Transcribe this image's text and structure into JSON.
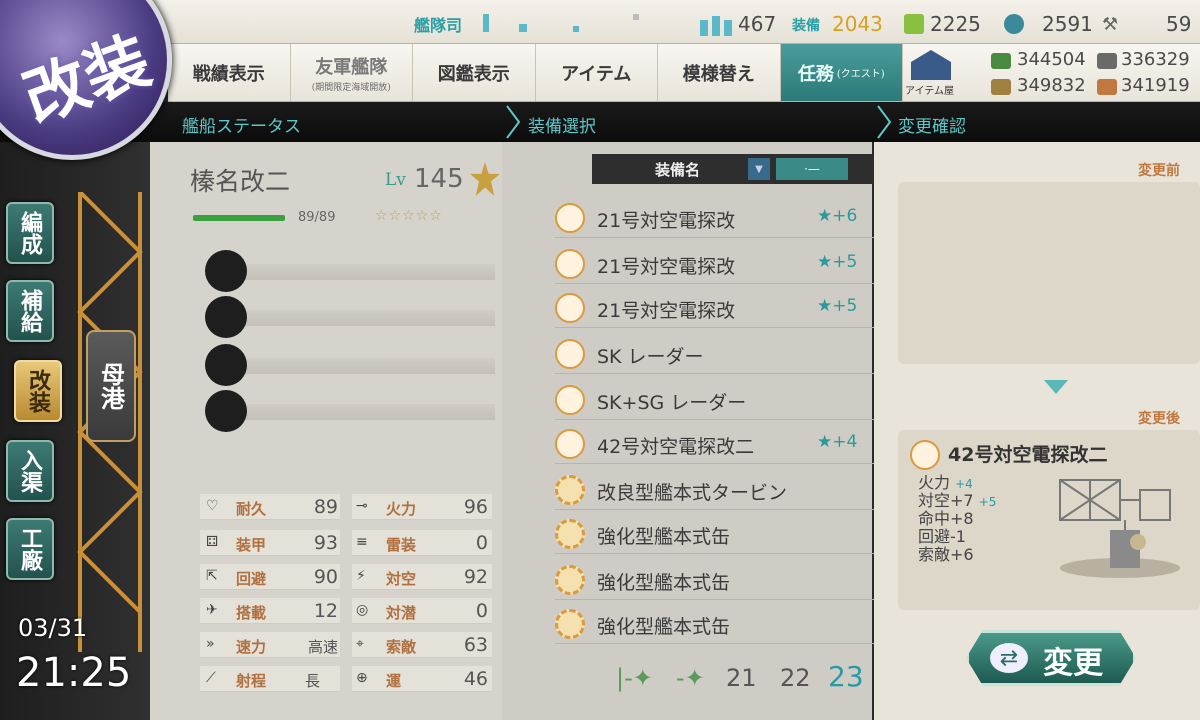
{
  "topbar": {
    "admiral_label": "艦隊司",
    "ship_count": "467",
    "equip_label": "装備",
    "equip_count": "2043",
    "bucket": "2225",
    "dev_material": "2591",
    "improve_material": "59"
  },
  "menu": {
    "items": [
      {
        "label": "戦績表示",
        "sub": ""
      },
      {
        "label": "友軍艦隊",
        "sub": "(期間限定海域開放)"
      },
      {
        "label": "図鑑表示",
        "sub": ""
      },
      {
        "label": "アイテム",
        "sub": ""
      },
      {
        "label": "模様替え",
        "sub": ""
      },
      {
        "label": "任務",
        "sub": "(クエスト)"
      }
    ],
    "item_shop_label": "アイテム屋"
  },
  "resources": {
    "fuel": "344504",
    "ammo": "349832",
    "steel": "336329",
    "bauxite": "341919"
  },
  "headers": {
    "ship_status": "艦船ステータス",
    "equip_select": "装備選択",
    "change_confirm": "変更確認"
  },
  "sidebar": {
    "kaisou_label": "改装",
    "nav": [
      "編成",
      "補給",
      "改装",
      "入渠",
      "工廠"
    ],
    "port_label": "母港",
    "date": "03/31",
    "time": "21:25"
  },
  "ship": {
    "name": "榛名改二",
    "lv_label": "Lv",
    "level": "145",
    "hp": "89/89",
    "stars": "☆☆☆☆☆",
    "stats_left": [
      {
        "label": "耐久",
        "value": "89"
      },
      {
        "label": "装甲",
        "value": "93"
      },
      {
        "label": "回避",
        "value": "90"
      },
      {
        "label": "搭載",
        "value": "12"
      },
      {
        "label": "速力",
        "value": "高速"
      },
      {
        "label": "射程",
        "value": "長"
      }
    ],
    "stats_right": [
      {
        "label": "火力",
        "value": "96"
      },
      {
        "label": "雷装",
        "value": "0"
      },
      {
        "label": "対空",
        "value": "92"
      },
      {
        "label": "対潜",
        "value": "0"
      },
      {
        "label": "索敵",
        "value": "63"
      },
      {
        "label": "運",
        "value": "46"
      }
    ]
  },
  "equip_list": {
    "header": "装備名",
    "items": [
      {
        "name": "21号対空電探改",
        "stars": "★+6",
        "icon": "radar-icon"
      },
      {
        "name": "21号対空電探改",
        "stars": "★+5",
        "icon": "radar-icon"
      },
      {
        "name": "21号対空電探改",
        "stars": "★+5",
        "icon": "radar-icon"
      },
      {
        "name": "SK レーダー",
        "stars": "",
        "icon": "radar-icon"
      },
      {
        "name": "SK+SG レーダー",
        "stars": "",
        "icon": "radar-icon"
      },
      {
        "name": "42号対空電探改二",
        "stars": "★+4",
        "icon": "radar-icon"
      },
      {
        "name": "改良型艦本式タービン",
        "stars": "",
        "icon": "turbine-icon"
      },
      {
        "name": "強化型艦本式缶",
        "stars": "",
        "icon": "boiler-icon"
      },
      {
        "name": "強化型艦本式缶",
        "stars": "",
        "icon": "boiler-icon"
      },
      {
        "name": "強化型艦本式缶",
        "stars": "",
        "icon": "boiler-icon"
      }
    ],
    "pages": [
      "21",
      "22",
      "23"
    ],
    "current_page": "23"
  },
  "confirm": {
    "before_label": "変更前",
    "after_label": "変更後",
    "after_name": "42号対空電探改二",
    "after_stats": [
      {
        "text": "火力",
        "bonus": "+4"
      },
      {
        "text": "対空+7",
        "bonus": "+5"
      },
      {
        "text": "命中+8",
        "bonus": ""
      },
      {
        "text": "回避-1",
        "bonus": ""
      },
      {
        "text": "索敵+6",
        "bonus": ""
      }
    ],
    "change_label": "変更"
  }
}
